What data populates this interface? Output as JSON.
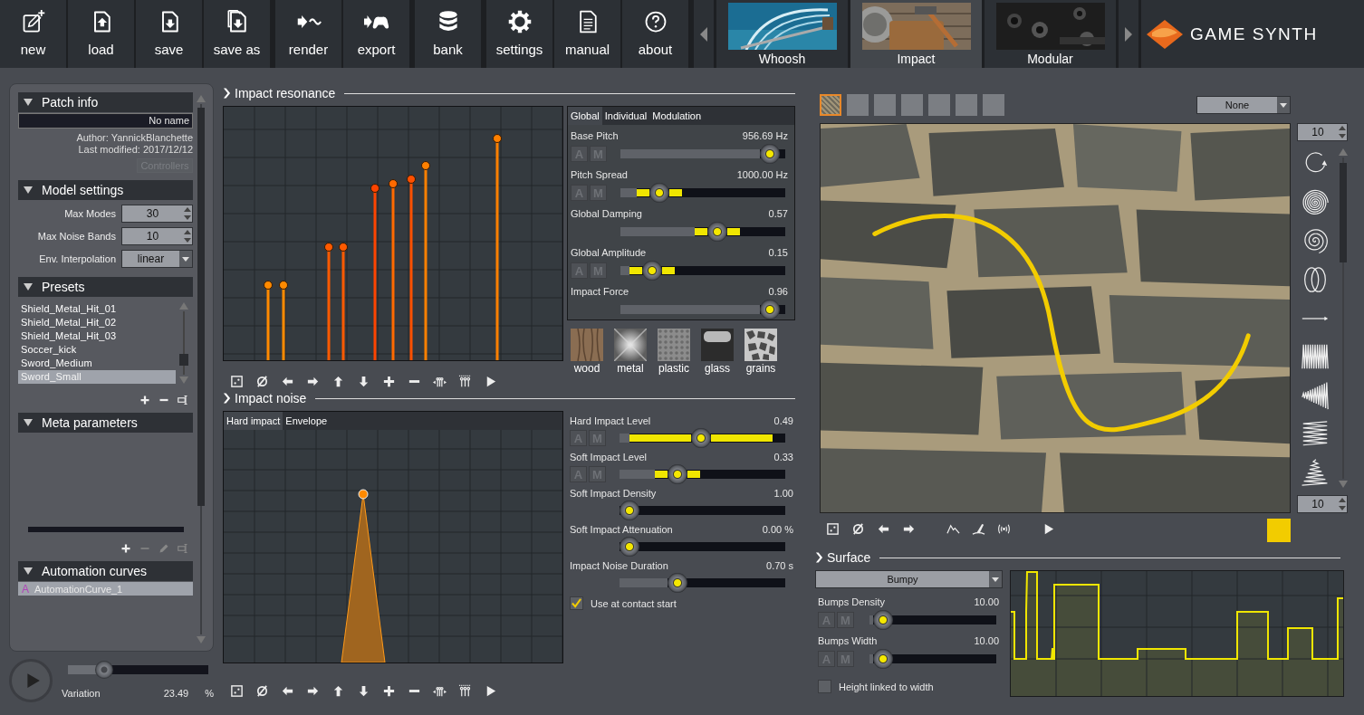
{
  "toolbar": {
    "groups": [
      [
        {
          "label": "new"
        },
        {
          "label": "load"
        },
        {
          "label": "save"
        },
        {
          "label": "save as"
        }
      ],
      [
        {
          "label": "render"
        },
        {
          "label": "export"
        }
      ],
      [
        {
          "label": "bank"
        }
      ],
      [
        {
          "label": "settings"
        },
        {
          "label": "manual"
        },
        {
          "label": "about"
        }
      ]
    ]
  },
  "model_tabs": [
    {
      "label": "Whoosh",
      "selected": false
    },
    {
      "label": "Impact",
      "selected": true
    },
    {
      "label": "Modular",
      "selected": false
    }
  ],
  "logo": {
    "text": "GAME SYNTH"
  },
  "left_panel": {
    "patch_info": {
      "title": "Patch info",
      "expanded": true,
      "name": "No name",
      "author": "Author: YannickBlanchette",
      "last_modified": "Last modified: 2017/12/12",
      "controllers_button": {
        "label": "Controllers",
        "disabled": true
      }
    },
    "model_settings": {
      "title": "Model settings",
      "expanded": true,
      "fields": [
        {
          "kind": "spinner",
          "label": "Max Modes",
          "value": "30"
        },
        {
          "kind": "spinner",
          "label": "Max Noise Bands",
          "value": "10"
        },
        {
          "kind": "dropdown",
          "label": "Env. Interpolation",
          "value": "linear"
        }
      ]
    },
    "presets": {
      "title": "Presets",
      "expanded": true,
      "items": [
        {
          "label": "Shield_Metal_Hit_01",
          "selected": false
        },
        {
          "label": "Shield_Metal_Hit_02",
          "selected": false
        },
        {
          "label": "Shield_Metal_Hit_03",
          "selected": false
        },
        {
          "label": "Soccer_kick",
          "selected": false
        },
        {
          "label": "Sword_Medium",
          "selected": false
        },
        {
          "label": "Sword_Small",
          "selected": true
        }
      ]
    },
    "meta_parameters": {
      "title": "Meta parameters",
      "expanded": true
    },
    "automation_curves": {
      "title": "Automation curves",
      "expanded": true,
      "items": [
        {
          "badge": "A",
          "label": "AutomationCurve_1",
          "selected": true
        }
      ]
    }
  },
  "variation": {
    "label": "Variation",
    "value": "23.49",
    "unit": "%",
    "level": 0.22
  },
  "impact_resonance": {
    "title": "Impact resonance",
    "param_tabs": [
      {
        "label": "Global",
        "selected": true
      },
      {
        "label": "Individual",
        "selected": false
      },
      {
        "label": "Modulation",
        "selected": false
      }
    ],
    "params": [
      {
        "kind": "plain",
        "label": "Base Pitch",
        "reading": "956.69 Hz",
        "level": 0.96,
        "am_buttons": [
          {
            "label": "A",
            "disabled": true
          },
          {
            "label": "M",
            "disabled": true
          }
        ]
      },
      {
        "kind": "banded",
        "label": "Pitch Spread",
        "reading": "1000.00 Hz",
        "level": 0.2,
        "am_buttons": [
          {
            "label": "A",
            "disabled": true
          },
          {
            "label": "M",
            "disabled": true
          }
        ]
      },
      {
        "kind": "banded",
        "label": "Global Damping",
        "reading": "0.57",
        "level": 0.6
      },
      {
        "kind": "banded",
        "label": "Global Amplitude",
        "reading": "0.15",
        "level": 0.15,
        "am_buttons": [
          {
            "label": "A",
            "disabled": true
          },
          {
            "label": "M",
            "disabled": true
          }
        ]
      },
      {
        "kind": "plain",
        "label": "Impact Force",
        "reading": "0.96",
        "level": 0.96
      }
    ],
    "materials": [
      {
        "label": "wood"
      },
      {
        "label": "metal"
      },
      {
        "label": "plastic"
      },
      {
        "label": "glass"
      },
      {
        "label": "grains"
      }
    ]
  },
  "impact_noise": {
    "title": "Impact noise",
    "graph_tabs": [
      {
        "label": "Hard impact",
        "selected": true
      },
      {
        "label": "Envelope",
        "selected": false
      }
    ],
    "params": [
      {
        "kind": "wideband",
        "label": "Hard Impact Level",
        "reading": "0.49",
        "level": 0.49,
        "am_buttons": [
          {
            "label": "A",
            "disabled": true
          },
          {
            "label": "M",
            "disabled": true
          }
        ]
      },
      {
        "kind": "banded",
        "label": "Soft Impact Level",
        "reading": "0.33",
        "level": 0.33,
        "am_buttons": [
          {
            "label": "A",
            "disabled": true
          },
          {
            "label": "M",
            "disabled": true
          }
        ]
      },
      {
        "kind": "plain",
        "label": "Soft Impact Density",
        "reading": "1.00",
        "level": 0
      },
      {
        "kind": "plain",
        "label": "Soft Impact Attenuation",
        "reading": "0.00 %",
        "level": 0
      },
      {
        "kind": "plain",
        "label": "Impact Noise Duration",
        "reading": "0.70 s",
        "level": 0.33
      }
    ],
    "checkbox": {
      "label": "Use at contact start",
      "checked": true
    }
  },
  "trajectory": {
    "slots": [
      {
        "kind": "texture",
        "selected": true
      },
      {
        "kind": "empty",
        "selected": false
      },
      {
        "kind": "empty",
        "selected": false
      },
      {
        "kind": "empty",
        "selected": false
      },
      {
        "kind": "empty",
        "selected": false
      },
      {
        "kind": "empty",
        "selected": false
      },
      {
        "kind": "empty",
        "selected": false
      }
    ],
    "dropdown": "None",
    "top_spinner": "10",
    "bottom_spinner": "10",
    "color": "#f2cc00"
  },
  "surface": {
    "title": "Surface",
    "dropdown": "Bumpy",
    "params": [
      {
        "label": "Bumps Density",
        "reading": "10.00",
        "level": 0.03,
        "am_buttons": [
          {
            "label": "A",
            "disabled": true
          },
          {
            "label": "M",
            "disabled": true
          }
        ]
      },
      {
        "label": "Bumps Width",
        "reading": "10.00",
        "level": 0.03,
        "am_buttons": [
          {
            "label": "A",
            "disabled": true
          },
          {
            "label": "M",
            "disabled": true
          }
        ]
      }
    ],
    "checkbox": {
      "label": "Height linked to width",
      "checked": false
    }
  }
}
